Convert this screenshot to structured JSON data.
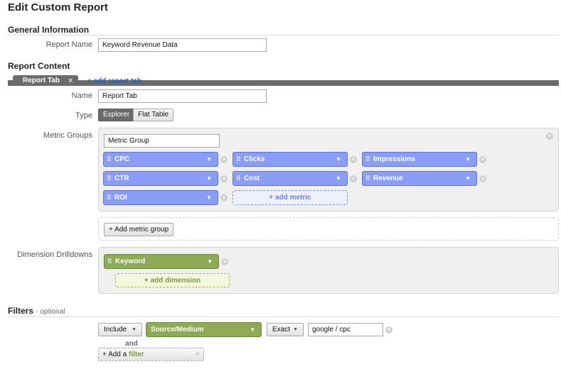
{
  "page": {
    "title": "Edit Custom Report"
  },
  "general": {
    "heading": "General Information",
    "report_name_label": "Report Name",
    "report_name_value": "Keyword Revenue Data"
  },
  "content": {
    "heading": "Report Content",
    "tab_label": "Report Tab",
    "tab_close": "×",
    "add_tab": "+ add report tab",
    "name_label": "Name",
    "name_value": "Report Tab",
    "type_label": "Type",
    "type_options": [
      "Explorer",
      "Flat Table"
    ],
    "type_selected": "Explorer"
  },
  "metrics": {
    "label": "Metric Groups",
    "group_name_value": "Metric Group",
    "items": [
      "CPC",
      "Clicks",
      "Impressions",
      "CTR",
      "Cost",
      "Revenue",
      "ROI"
    ],
    "add_metric": "+ add metric",
    "add_group": "+ Add metric group"
  },
  "dimensions": {
    "label": "Dimension Drilldowns",
    "items": [
      "Keyword"
    ],
    "add_dimension": "+ add dimension"
  },
  "filters": {
    "heading": "Filters",
    "optional": "- optional",
    "include": "Include",
    "dimension": "Source/Medium",
    "match": "Exact",
    "value": "google / cpc",
    "and": "and",
    "add_prefix": "+ Add a",
    "add_word": "filter"
  },
  "icons": {
    "remove": "×",
    "caret": "▼",
    "grip": "⠿"
  },
  "colors": {
    "metric_chip": "#8a9ef8",
    "dimension_chip": "#8faa56",
    "tab": "#6b6b6b",
    "link": "#2a5db0"
  }
}
